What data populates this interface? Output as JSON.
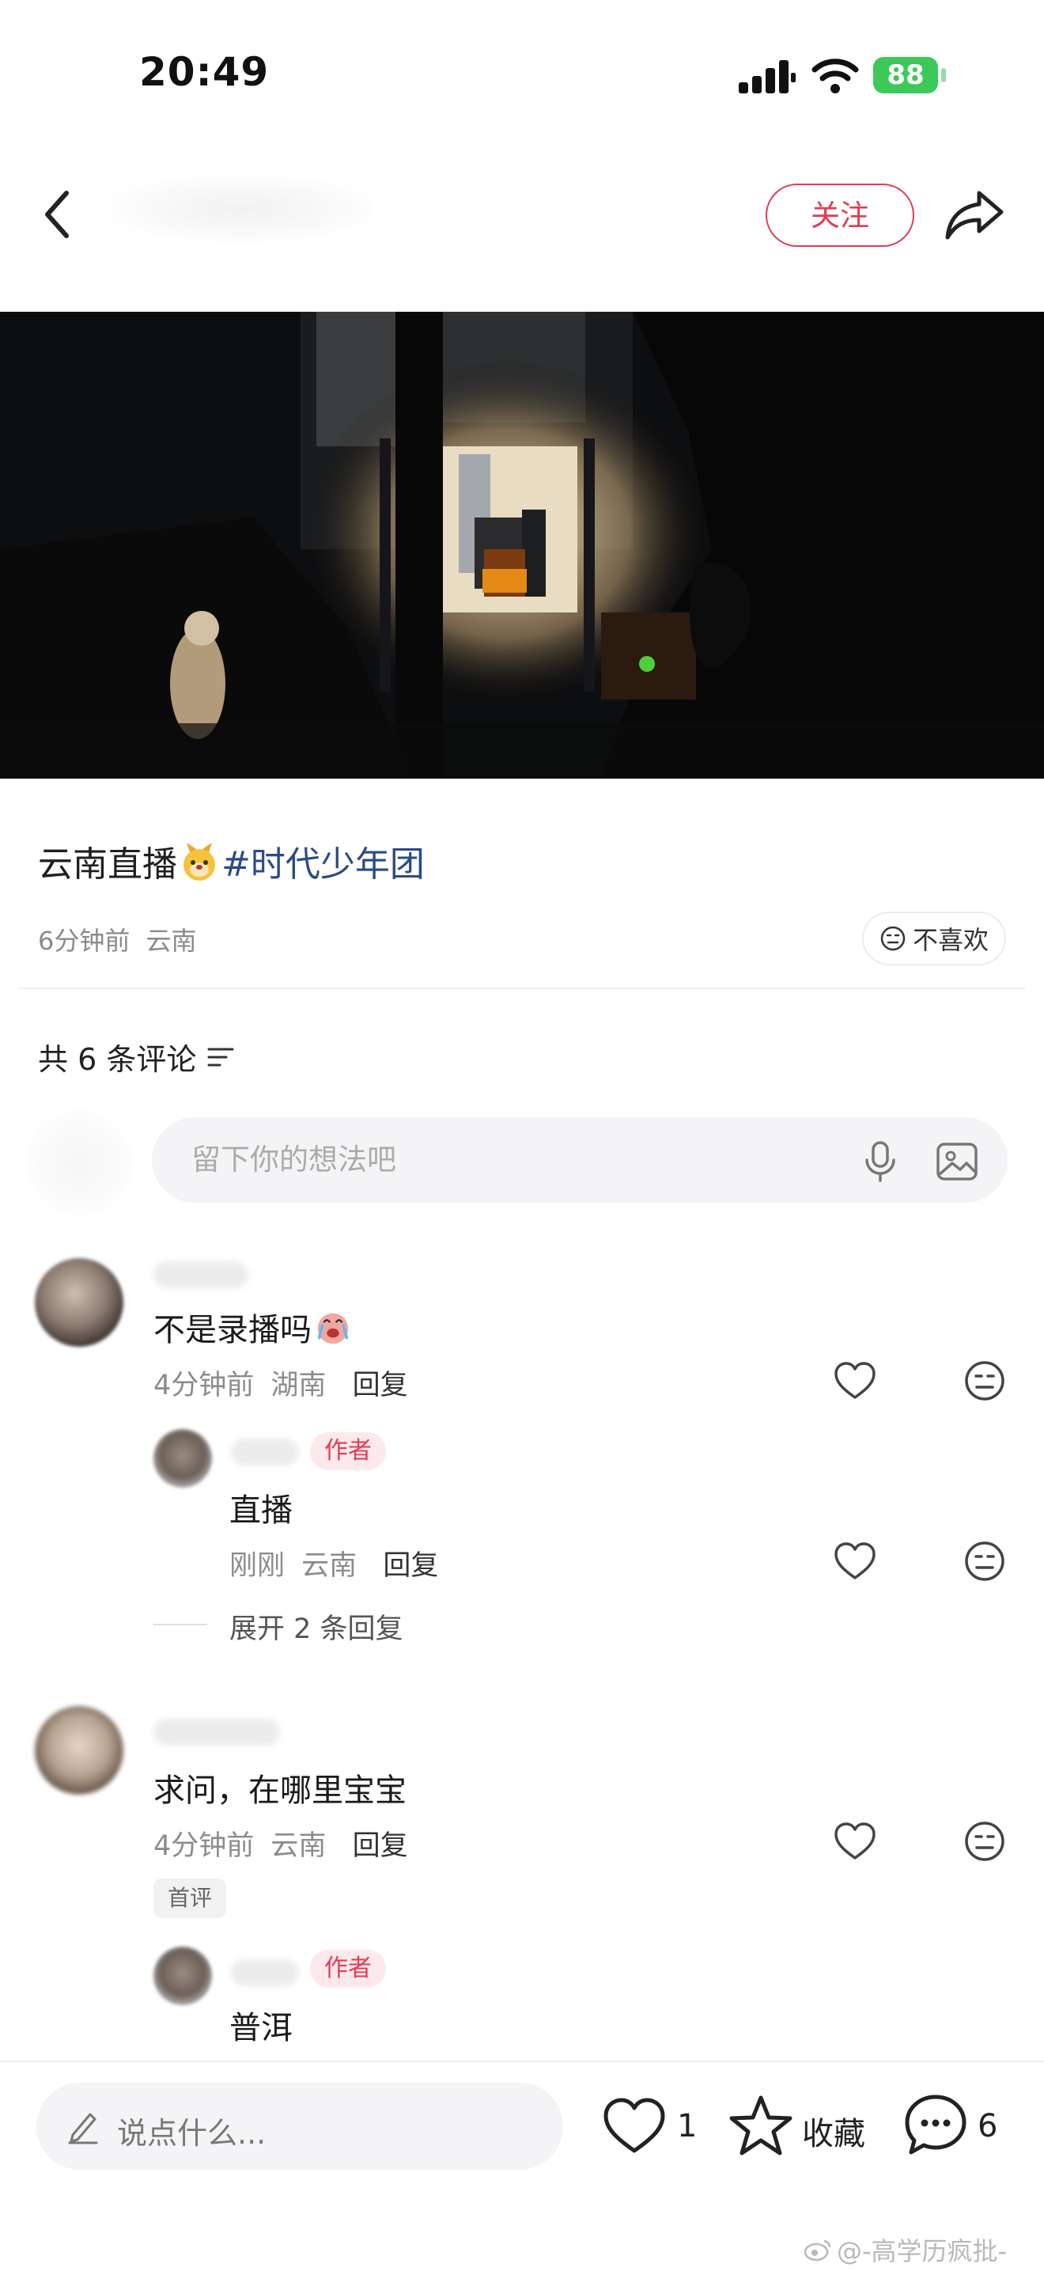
{
  "status_bar": {
    "time": "20:49",
    "battery": "88"
  },
  "header": {
    "follow_label": "关注"
  },
  "post": {
    "title_text": "云南直播",
    "hashtag": "#时代少年团",
    "time": "6分钟前",
    "location": "云南",
    "dislike_label": "不喜欢"
  },
  "comments_section": {
    "count_label": "共 6 条评论",
    "input_placeholder": "留下你的想法吧",
    "comments": [
      {
        "text": "不是录播吗",
        "time": "4分钟前",
        "location": "湖南",
        "reply_label": "回复",
        "replies": [
          {
            "badge": "作者",
            "text": "直播",
            "time": "刚刚",
            "location": "云南",
            "reply_label": "回复"
          }
        ],
        "expand_label": "展开 2 条回复"
      },
      {
        "text": "求问，在哪里宝宝",
        "time": "4分钟前",
        "location": "云南",
        "reply_label": "回复",
        "first_badge": "首评",
        "replies": [
          {
            "badge": "作者",
            "text": "普洱"
          }
        ]
      }
    ]
  },
  "bottom_bar": {
    "input_placeholder": "说点什么...",
    "like_count": "1",
    "favorite_label": "收藏",
    "comment_count": "6"
  },
  "watermark": "@-高学历疯批-",
  "colors": {
    "accent": "#e23b53",
    "hashtag": "#2a4b87",
    "battery": "#3cc95a"
  }
}
